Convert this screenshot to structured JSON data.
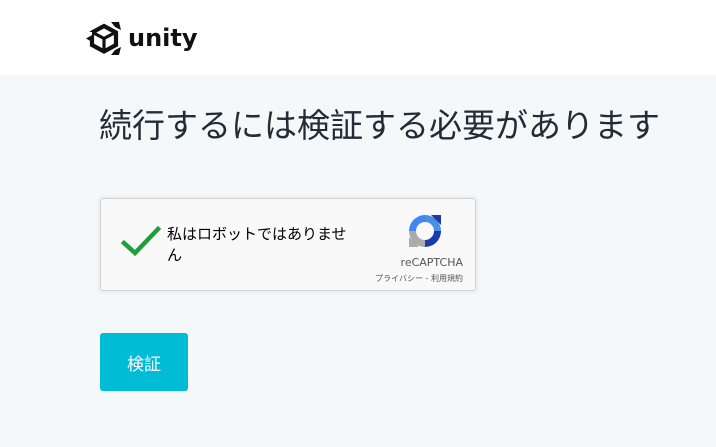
{
  "header": {
    "logo_text": "unity",
    "logo_icon": "unity-cube-icon"
  },
  "main": {
    "title": "続行するには検証する必要があります"
  },
  "recaptcha": {
    "checkbox_checked": true,
    "checkbox_icon": "checkmark-icon",
    "label": "私はロボットではありません",
    "brand": "reCAPTCHA",
    "privacy_link": "プライバシー",
    "separator": " - ",
    "terms_link": "利用規約",
    "logo_icon": "recaptcha-logo-icon",
    "check_color": "#1e9e3e"
  },
  "actions": {
    "verify_label": "検証",
    "verify_color": "#00bcd4"
  },
  "colors": {
    "page_background": "#f5f8f9",
    "header_background": "#ffffff",
    "title_text": "#222c37"
  }
}
